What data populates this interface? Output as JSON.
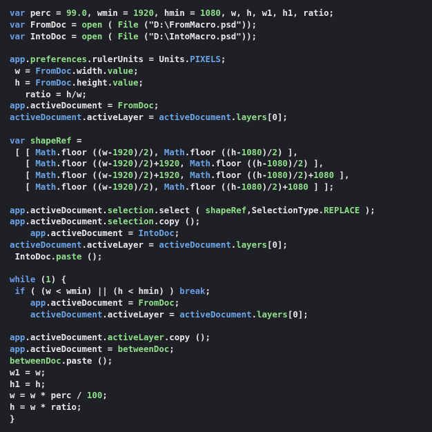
{
  "editor": {
    "background_color": "#1f1f26",
    "default_text_color": "#e8e8e8",
    "keyword_color": "#6c9ce8",
    "identifier_blue_color": "#6aa6e8",
    "literal_green_color": "#8fe08a",
    "language": "JavaScript",
    "total_lines": 39
  },
  "code": {
    "lines": [
      [
        {
          "t": "var",
          "c": "kw"
        },
        {
          "t": " perc = ",
          "c": "wht"
        },
        {
          "t": "99.0",
          "c": "grn"
        },
        {
          "t": ", wmin = ",
          "c": "wht"
        },
        {
          "t": "1920",
          "c": "grn"
        },
        {
          "t": ", hmin = ",
          "c": "wht"
        },
        {
          "t": "1080",
          "c": "grn"
        },
        {
          "t": ", w, h, w1, h1, ratio;",
          "c": "wht"
        }
      ],
      [
        {
          "t": "var",
          "c": "kw"
        },
        {
          "t": " FromDoc = ",
          "c": "wht"
        },
        {
          "t": "open",
          "c": "grn"
        },
        {
          "t": " ( ",
          "c": "wht"
        },
        {
          "t": "File",
          "c": "grn"
        },
        {
          "t": " (\"D:\\FromMacro.psd\"));",
          "c": "wht"
        }
      ],
      [
        {
          "t": "var",
          "c": "kw"
        },
        {
          "t": " IntoDoc = ",
          "c": "wht"
        },
        {
          "t": "open",
          "c": "grn"
        },
        {
          "t": " ( ",
          "c": "wht"
        },
        {
          "t": "File",
          "c": "grn"
        },
        {
          "t": " (\"D:\\IntoMacro.psd\"));",
          "c": "wht"
        }
      ],
      [],
      [
        {
          "t": "app",
          "c": "blu"
        },
        {
          "t": ".",
          "c": "wht"
        },
        {
          "t": "preferences",
          "c": "grn"
        },
        {
          "t": ".rulerUnits = Units.",
          "c": "wht"
        },
        {
          "t": "PIXELS",
          "c": "blu"
        },
        {
          "t": ";",
          "c": "wht"
        }
      ],
      [
        {
          "t": " w = ",
          "c": "wht"
        },
        {
          "t": "FromDoc",
          "c": "blu"
        },
        {
          "t": ".width.",
          "c": "wht"
        },
        {
          "t": "value",
          "c": "grn"
        },
        {
          "t": ";",
          "c": "wht"
        }
      ],
      [
        {
          "t": " h = ",
          "c": "wht"
        },
        {
          "t": "FromDoc",
          "c": "blu"
        },
        {
          "t": ".height.",
          "c": "wht"
        },
        {
          "t": "value",
          "c": "grn"
        },
        {
          "t": ";",
          "c": "wht"
        }
      ],
      [
        {
          "t": "   ratio = h/w;",
          "c": "wht"
        }
      ],
      [
        {
          "t": "app",
          "c": "blu"
        },
        {
          "t": ".activeDocument = ",
          "c": "wht"
        },
        {
          "t": "FromDoc",
          "c": "grn"
        },
        {
          "t": ";",
          "c": "wht"
        }
      ],
      [
        {
          "t": "activeDocument",
          "c": "blu"
        },
        {
          "t": ".activeLayer = ",
          "c": "wht"
        },
        {
          "t": "activeDocument",
          "c": "blu"
        },
        {
          "t": ".",
          "c": "wht"
        },
        {
          "t": "layers",
          "c": "grn"
        },
        {
          "t": "[0];",
          "c": "wht"
        }
      ],
      [],
      [
        {
          "t": "var",
          "c": "kw"
        },
        {
          "t": " ",
          "c": "wht"
        },
        {
          "t": "shapeRef",
          "c": "grn"
        },
        {
          "t": " =",
          "c": "wht"
        }
      ],
      [
        {
          "t": " [ [ ",
          "c": "wht"
        },
        {
          "t": "Math",
          "c": "blu"
        },
        {
          "t": ".floor ((w-",
          "c": "wht"
        },
        {
          "t": "1920",
          "c": "grn"
        },
        {
          "t": ")/",
          "c": "wht"
        },
        {
          "t": "2",
          "c": "grn"
        },
        {
          "t": "), ",
          "c": "wht"
        },
        {
          "t": "Math",
          "c": "blu"
        },
        {
          "t": ".floor ((h-",
          "c": "wht"
        },
        {
          "t": "1080",
          "c": "grn"
        },
        {
          "t": ")/",
          "c": "wht"
        },
        {
          "t": "2",
          "c": "grn"
        },
        {
          "t": ") ],",
          "c": "wht"
        }
      ],
      [
        {
          "t": "   [ ",
          "c": "wht"
        },
        {
          "t": "Math",
          "c": "blu"
        },
        {
          "t": ".floor ((w-",
          "c": "wht"
        },
        {
          "t": "1920",
          "c": "grn"
        },
        {
          "t": ")/",
          "c": "wht"
        },
        {
          "t": "2",
          "c": "grn"
        },
        {
          "t": ")+",
          "c": "wht"
        },
        {
          "t": "1920",
          "c": "grn"
        },
        {
          "t": ", ",
          "c": "wht"
        },
        {
          "t": "Math",
          "c": "blu"
        },
        {
          "t": ".floor ((h-",
          "c": "wht"
        },
        {
          "t": "1080",
          "c": "grn"
        },
        {
          "t": ")/",
          "c": "wht"
        },
        {
          "t": "2",
          "c": "grn"
        },
        {
          "t": ") ],",
          "c": "wht"
        }
      ],
      [
        {
          "t": "   [ ",
          "c": "wht"
        },
        {
          "t": "Math",
          "c": "blu"
        },
        {
          "t": ".floor ((w-",
          "c": "wht"
        },
        {
          "t": "1920",
          "c": "grn"
        },
        {
          "t": ")/",
          "c": "wht"
        },
        {
          "t": "2",
          "c": "grn"
        },
        {
          "t": ")+",
          "c": "wht"
        },
        {
          "t": "1920",
          "c": "grn"
        },
        {
          "t": ", ",
          "c": "wht"
        },
        {
          "t": "Math",
          "c": "blu"
        },
        {
          "t": ".floor ((h-",
          "c": "wht"
        },
        {
          "t": "1080",
          "c": "grn"
        },
        {
          "t": ")/",
          "c": "wht"
        },
        {
          "t": "2",
          "c": "grn"
        },
        {
          "t": ")+",
          "c": "wht"
        },
        {
          "t": "1080",
          "c": "grn"
        },
        {
          "t": " ],",
          "c": "wht"
        }
      ],
      [
        {
          "t": "   [ ",
          "c": "wht"
        },
        {
          "t": "Math",
          "c": "blu"
        },
        {
          "t": ".floor ((w-",
          "c": "wht"
        },
        {
          "t": "1920",
          "c": "grn"
        },
        {
          "t": ")/",
          "c": "wht"
        },
        {
          "t": "2",
          "c": "grn"
        },
        {
          "t": "), ",
          "c": "wht"
        },
        {
          "t": "Math",
          "c": "blu"
        },
        {
          "t": ".floor ((h-",
          "c": "wht"
        },
        {
          "t": "1080",
          "c": "grn"
        },
        {
          "t": ")/",
          "c": "wht"
        },
        {
          "t": "2",
          "c": "grn"
        },
        {
          "t": ")+",
          "c": "wht"
        },
        {
          "t": "1080",
          "c": "grn"
        },
        {
          "t": " ] ];",
          "c": "wht"
        }
      ],
      [],
      [
        {
          "t": "app",
          "c": "blu"
        },
        {
          "t": ".activeDocument.",
          "c": "wht"
        },
        {
          "t": "selection",
          "c": "grn"
        },
        {
          "t": ".select ( ",
          "c": "wht"
        },
        {
          "t": "shapeRef",
          "c": "grn"
        },
        {
          "t": ",SelectionType.",
          "c": "wht"
        },
        {
          "t": "REPLACE",
          "c": "grn"
        },
        {
          "t": " );",
          "c": "wht"
        }
      ],
      [
        {
          "t": "app",
          "c": "blu"
        },
        {
          "t": ".activeDocument.",
          "c": "wht"
        },
        {
          "t": "selection",
          "c": "grn"
        },
        {
          "t": ".copy ();",
          "c": "wht"
        }
      ],
      [
        {
          "t": "    app",
          "c": "blu"
        },
        {
          "t": ".activeDocument = ",
          "c": "wht"
        },
        {
          "t": "IntoDoc",
          "c": "blu"
        },
        {
          "t": ";",
          "c": "wht"
        }
      ],
      [
        {
          "t": "activeDocument",
          "c": "blu"
        },
        {
          "t": ".activeLayer = ",
          "c": "wht"
        },
        {
          "t": "activeDocument",
          "c": "blu"
        },
        {
          "t": ".",
          "c": "wht"
        },
        {
          "t": "layers",
          "c": "grn"
        },
        {
          "t": "[0];",
          "c": "wht"
        }
      ],
      [
        {
          "t": " IntoDoc.",
          "c": "wht"
        },
        {
          "t": "paste",
          "c": "grn"
        },
        {
          "t": " ();",
          "c": "wht"
        }
      ],
      [],
      [
        {
          "t": "while",
          "c": "kw"
        },
        {
          "t": " (",
          "c": "wht"
        },
        {
          "t": "1",
          "c": "grn"
        },
        {
          "t": ") {",
          "c": "wht"
        }
      ],
      [
        {
          "t": " ",
          "c": "wht"
        },
        {
          "t": "if",
          "c": "kw"
        },
        {
          "t": " ( (w < wmin) || (h < hmin) ) ",
          "c": "wht"
        },
        {
          "t": "break",
          "c": "kw"
        },
        {
          "t": ";",
          "c": "wht"
        }
      ],
      [
        {
          "t": "    app",
          "c": "blu"
        },
        {
          "t": ".activeDocument = ",
          "c": "wht"
        },
        {
          "t": "FromDoc",
          "c": "grn"
        },
        {
          "t": ";",
          "c": "wht"
        }
      ],
      [
        {
          "t": "    ",
          "c": "wht"
        },
        {
          "t": "activeDocument",
          "c": "blu"
        },
        {
          "t": ".activeLayer = ",
          "c": "wht"
        },
        {
          "t": "activeDocument",
          "c": "blu"
        },
        {
          "t": ".",
          "c": "wht"
        },
        {
          "t": "layers",
          "c": "grn"
        },
        {
          "t": "[0];",
          "c": "wht"
        }
      ],
      [],
      [
        {
          "t": "app",
          "c": "blu"
        },
        {
          "t": ".activeDocument.",
          "c": "wht"
        },
        {
          "t": "activeLayer",
          "c": "grn"
        },
        {
          "t": ".copy ();",
          "c": "wht"
        }
      ],
      [
        {
          "t": "app",
          "c": "blu"
        },
        {
          "t": ".activeDocument = ",
          "c": "wht"
        },
        {
          "t": "betweenDoc",
          "c": "grn"
        },
        {
          "t": ";",
          "c": "wht"
        }
      ],
      [
        {
          "t": "betweenDoc",
          "c": "grn"
        },
        {
          "t": ".paste ();",
          "c": "wht"
        }
      ],
      [
        {
          "t": "w1 = w;",
          "c": "wht"
        }
      ],
      [
        {
          "t": "h1 = h;",
          "c": "wht"
        }
      ],
      [
        {
          "t": "w = w * perc / ",
          "c": "wht"
        },
        {
          "t": "100",
          "c": "grn"
        },
        {
          "t": ";",
          "c": "wht"
        }
      ],
      [
        {
          "t": "h = w * ratio;",
          "c": "wht"
        }
      ],
      [
        {
          "t": "}",
          "c": "wht"
        }
      ]
    ]
  }
}
